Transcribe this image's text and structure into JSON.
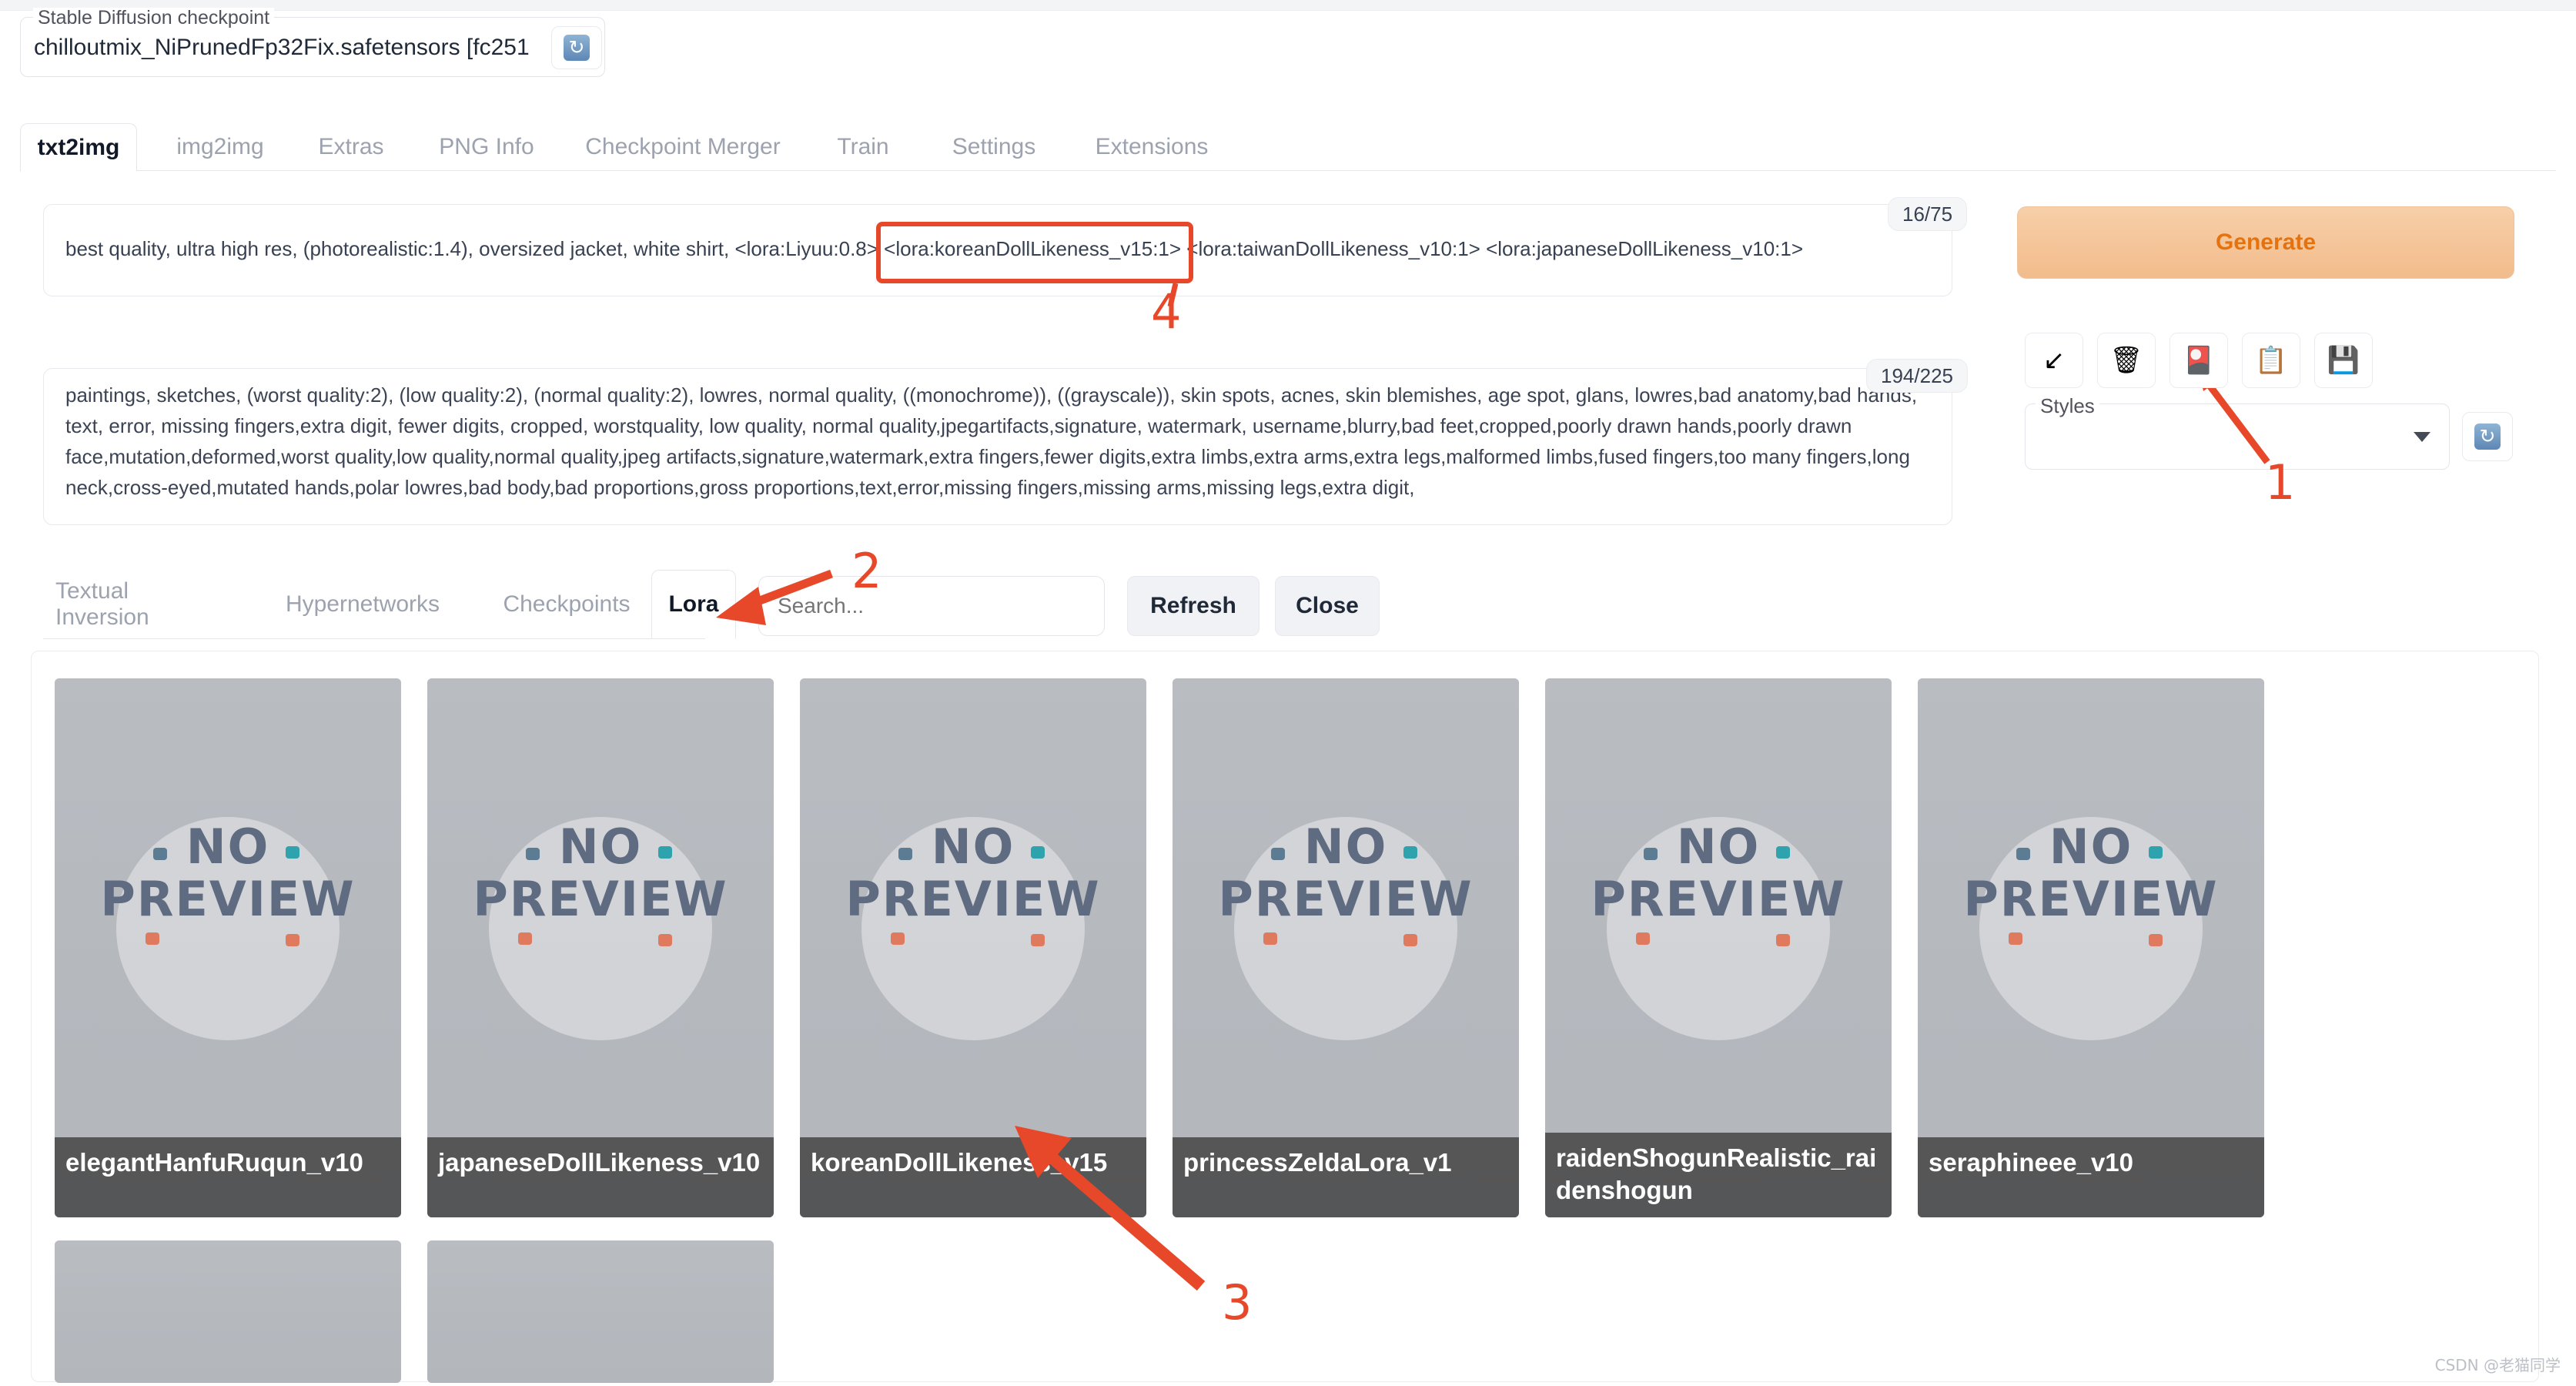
{
  "checkpoint": {
    "legend": "Stable Diffusion checkpoint",
    "value": "chilloutmix_NiPrunedFp32Fix.safetensors [fc251",
    "chevron_icon": "chevron-down-icon",
    "refresh_icon": "refresh-icon"
  },
  "main_tabs": [
    {
      "label": "txt2img",
      "active": true
    },
    {
      "label": "img2img",
      "active": false
    },
    {
      "label": "Extras",
      "active": false
    },
    {
      "label": "PNG Info",
      "active": false
    },
    {
      "label": "Checkpoint Merger",
      "active": false
    },
    {
      "label": "Train",
      "active": false
    },
    {
      "label": "Settings",
      "active": false
    },
    {
      "label": "Extensions",
      "active": false
    }
  ],
  "prompt": {
    "value": "best quality, ultra high res, (photorealistic:1.4), oversized jacket, white shirt, <lora:Liyuu:0.8> <lora:koreanDollLikeness_v15:1> <lora:taiwanDollLikeness_v10:1> <lora:japaneseDollLikeness_v10:1>",
    "token_count": "16/75"
  },
  "negative_prompt": {
    "value": "paintings, sketches, (worst quality:2), (low quality:2), (normal quality:2), lowres, normal quality, ((monochrome)), ((grayscale)), skin spots, acnes, skin blemishes, age spot, glans, lowres,bad anatomy,bad hands, text, error, missing fingers,extra digit, fewer digits, cropped, worstquality, low quality, normal quality,jpegartifacts,signature, watermark, username,blurry,bad feet,cropped,poorly drawn hands,poorly drawn face,mutation,deformed,worst quality,low quality,normal quality,jpeg artifacts,signature,watermark,extra fingers,fewer digits,extra limbs,extra arms,extra legs,malformed limbs,fused fingers,too many fingers,long neck,cross-eyed,mutated hands,polar lowres,bad body,bad proportions,gross proportions,text,error,missing fingers,missing arms,missing legs,extra digit,",
    "token_count": "194/225"
  },
  "right_panel": {
    "generate_label": "Generate",
    "tool_buttons": [
      {
        "icon": "arrow-down-left-icon",
        "glyph": "↙"
      },
      {
        "icon": "trash-icon",
        "glyph": "🗑"
      },
      {
        "icon": "extra-networks-icon",
        "glyph": "🎴"
      },
      {
        "icon": "clipboard-icon",
        "glyph": "📋"
      },
      {
        "icon": "save-icon",
        "glyph": "💾"
      }
    ],
    "styles_legend": "Styles",
    "styles_value": "",
    "styles_caret_icon": "caret-down-icon",
    "styles_refresh_icon": "refresh-icon"
  },
  "extra_networks": {
    "tabs": [
      {
        "label": "Textual Inversion",
        "active": false
      },
      {
        "label": "Hypernetworks",
        "active": false
      },
      {
        "label": "Checkpoints",
        "active": false
      },
      {
        "label": "Lora",
        "active": true
      }
    ],
    "search_placeholder": "Search...",
    "search_value": "",
    "refresh_label": "Refresh",
    "close_label": "Close",
    "preview_placeholder_text_line1": "NO",
    "preview_placeholder_text_line2": "PREVIEW",
    "cards": [
      {
        "name": "elegantHanfuRuqun_v10"
      },
      {
        "name": "japaneseDollLikeness_v10"
      },
      {
        "name": "koreanDollLikeness_v15"
      },
      {
        "name": "princessZeldaLora_v1"
      },
      {
        "name": "raidenShogunRealistic_raidenshogun"
      },
      {
        "name": "seraphineee_v10"
      }
    ],
    "cards_row2": [
      {
        "name": ""
      },
      {
        "name": ""
      }
    ]
  },
  "annotations": {
    "accent_color": "#e8482a",
    "markers": [
      {
        "id": "1",
        "label": "1"
      },
      {
        "id": "2",
        "label": "2"
      },
      {
        "id": "3",
        "label": "3"
      },
      {
        "id": "4",
        "label": "4"
      }
    ]
  },
  "watermark": "CSDN @老猫同学"
}
